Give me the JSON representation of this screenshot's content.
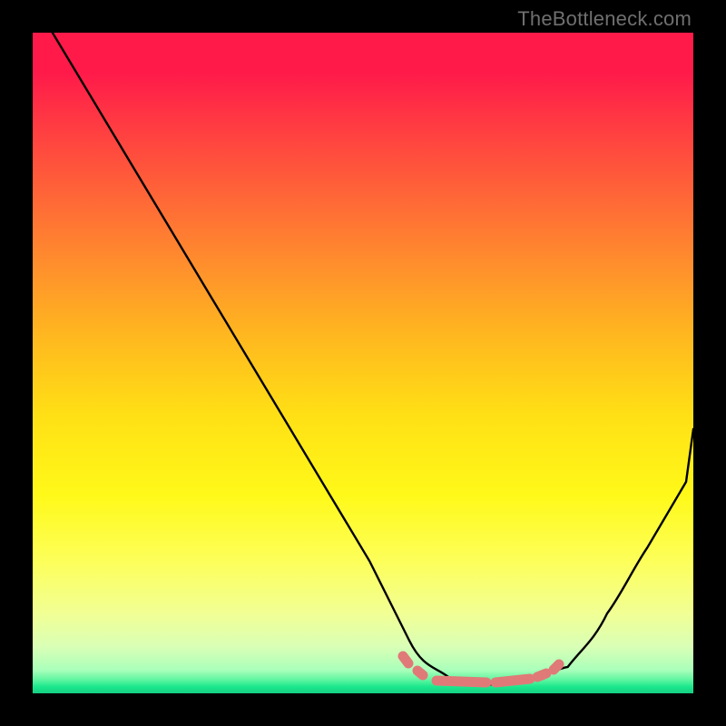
{
  "attribution": "TheBottleneck.com",
  "chart_data": {
    "type": "line",
    "title": "",
    "xlabel": "",
    "ylabel": "",
    "xlim": [
      0,
      100
    ],
    "ylim": [
      0,
      100
    ],
    "series": [
      {
        "name": "bottleneck-curve",
        "x": [
          3,
          9,
          15,
          21,
          27,
          33,
          39,
          45,
          51,
          55,
          57,
          61,
          65,
          69,
          73,
          77,
          81,
          85,
          89,
          93,
          97,
          100
        ],
        "y": [
          100,
          90,
          80,
          70,
          60,
          50,
          40,
          30,
          20,
          12,
          8,
          4,
          2,
          1.5,
          1.5,
          2,
          4,
          8,
          14,
          22,
          32,
          40
        ]
      }
    ],
    "annotations": [
      {
        "name": "optimal-region",
        "x_start": 56,
        "x_end": 78,
        "y": 2
      }
    ],
    "legend": false,
    "grid": false
  }
}
